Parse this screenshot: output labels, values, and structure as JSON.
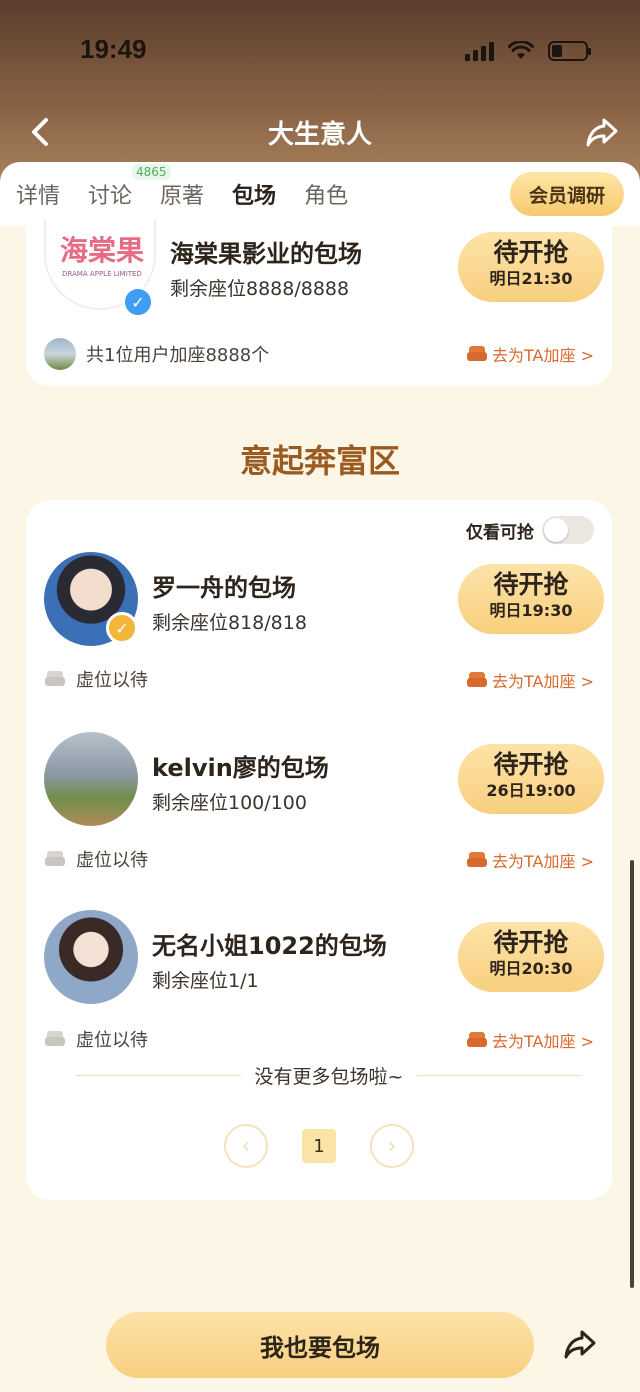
{
  "status": {
    "time": "19:49"
  },
  "nav": {
    "title": "大生意人"
  },
  "tabs": [
    {
      "label": "详情"
    },
    {
      "label": "讨论",
      "badge": "4865"
    },
    {
      "label": "原著"
    },
    {
      "label": "包场",
      "active": true
    },
    {
      "label": "角色"
    }
  ],
  "member_button": "会员调研",
  "top_card": {
    "logo_text": "海棠果",
    "logo_sub": "DRAMA APPLE LIMITED",
    "title": "海棠果影业的包场",
    "seats": "剩余座位8888/8888",
    "button_main": "待开抢",
    "button_time": "明日21:30",
    "foot_left": "共1位用户加座8888个",
    "foot_right": "去为TA加座 >"
  },
  "section_title": "意起奔富区",
  "filter_label": "仅看可抢",
  "rows": [
    {
      "title": "罗一舟的包场",
      "seats": "剩余座位818/818",
      "button_main": "待开抢",
      "button_time": "明日19:30",
      "foot_left": "虚位以待",
      "foot_right": "去为TA加座 >"
    },
    {
      "title": "kelvin廖的包场",
      "seats": "剩余座位100/100",
      "button_main": "待开抢",
      "button_time": "26日19:00",
      "foot_left": "虚位以待",
      "foot_right": "去为TA加座 >"
    },
    {
      "title": "无名小姐1022的包场",
      "seats": "剩余座位1/1",
      "button_main": "待开抢",
      "button_time": "明日20:30",
      "foot_left": "虚位以待",
      "foot_right": "去为TA加座 >"
    }
  ],
  "end_text": "没有更多包场啦~",
  "pager": {
    "prev": "‹",
    "current": "1",
    "next": "›"
  },
  "bottom": {
    "cta": "我也要包场"
  },
  "colors": {
    "accent": "#f8cf7f",
    "orange": "#d66a2e",
    "section": "#9b5a1f"
  }
}
